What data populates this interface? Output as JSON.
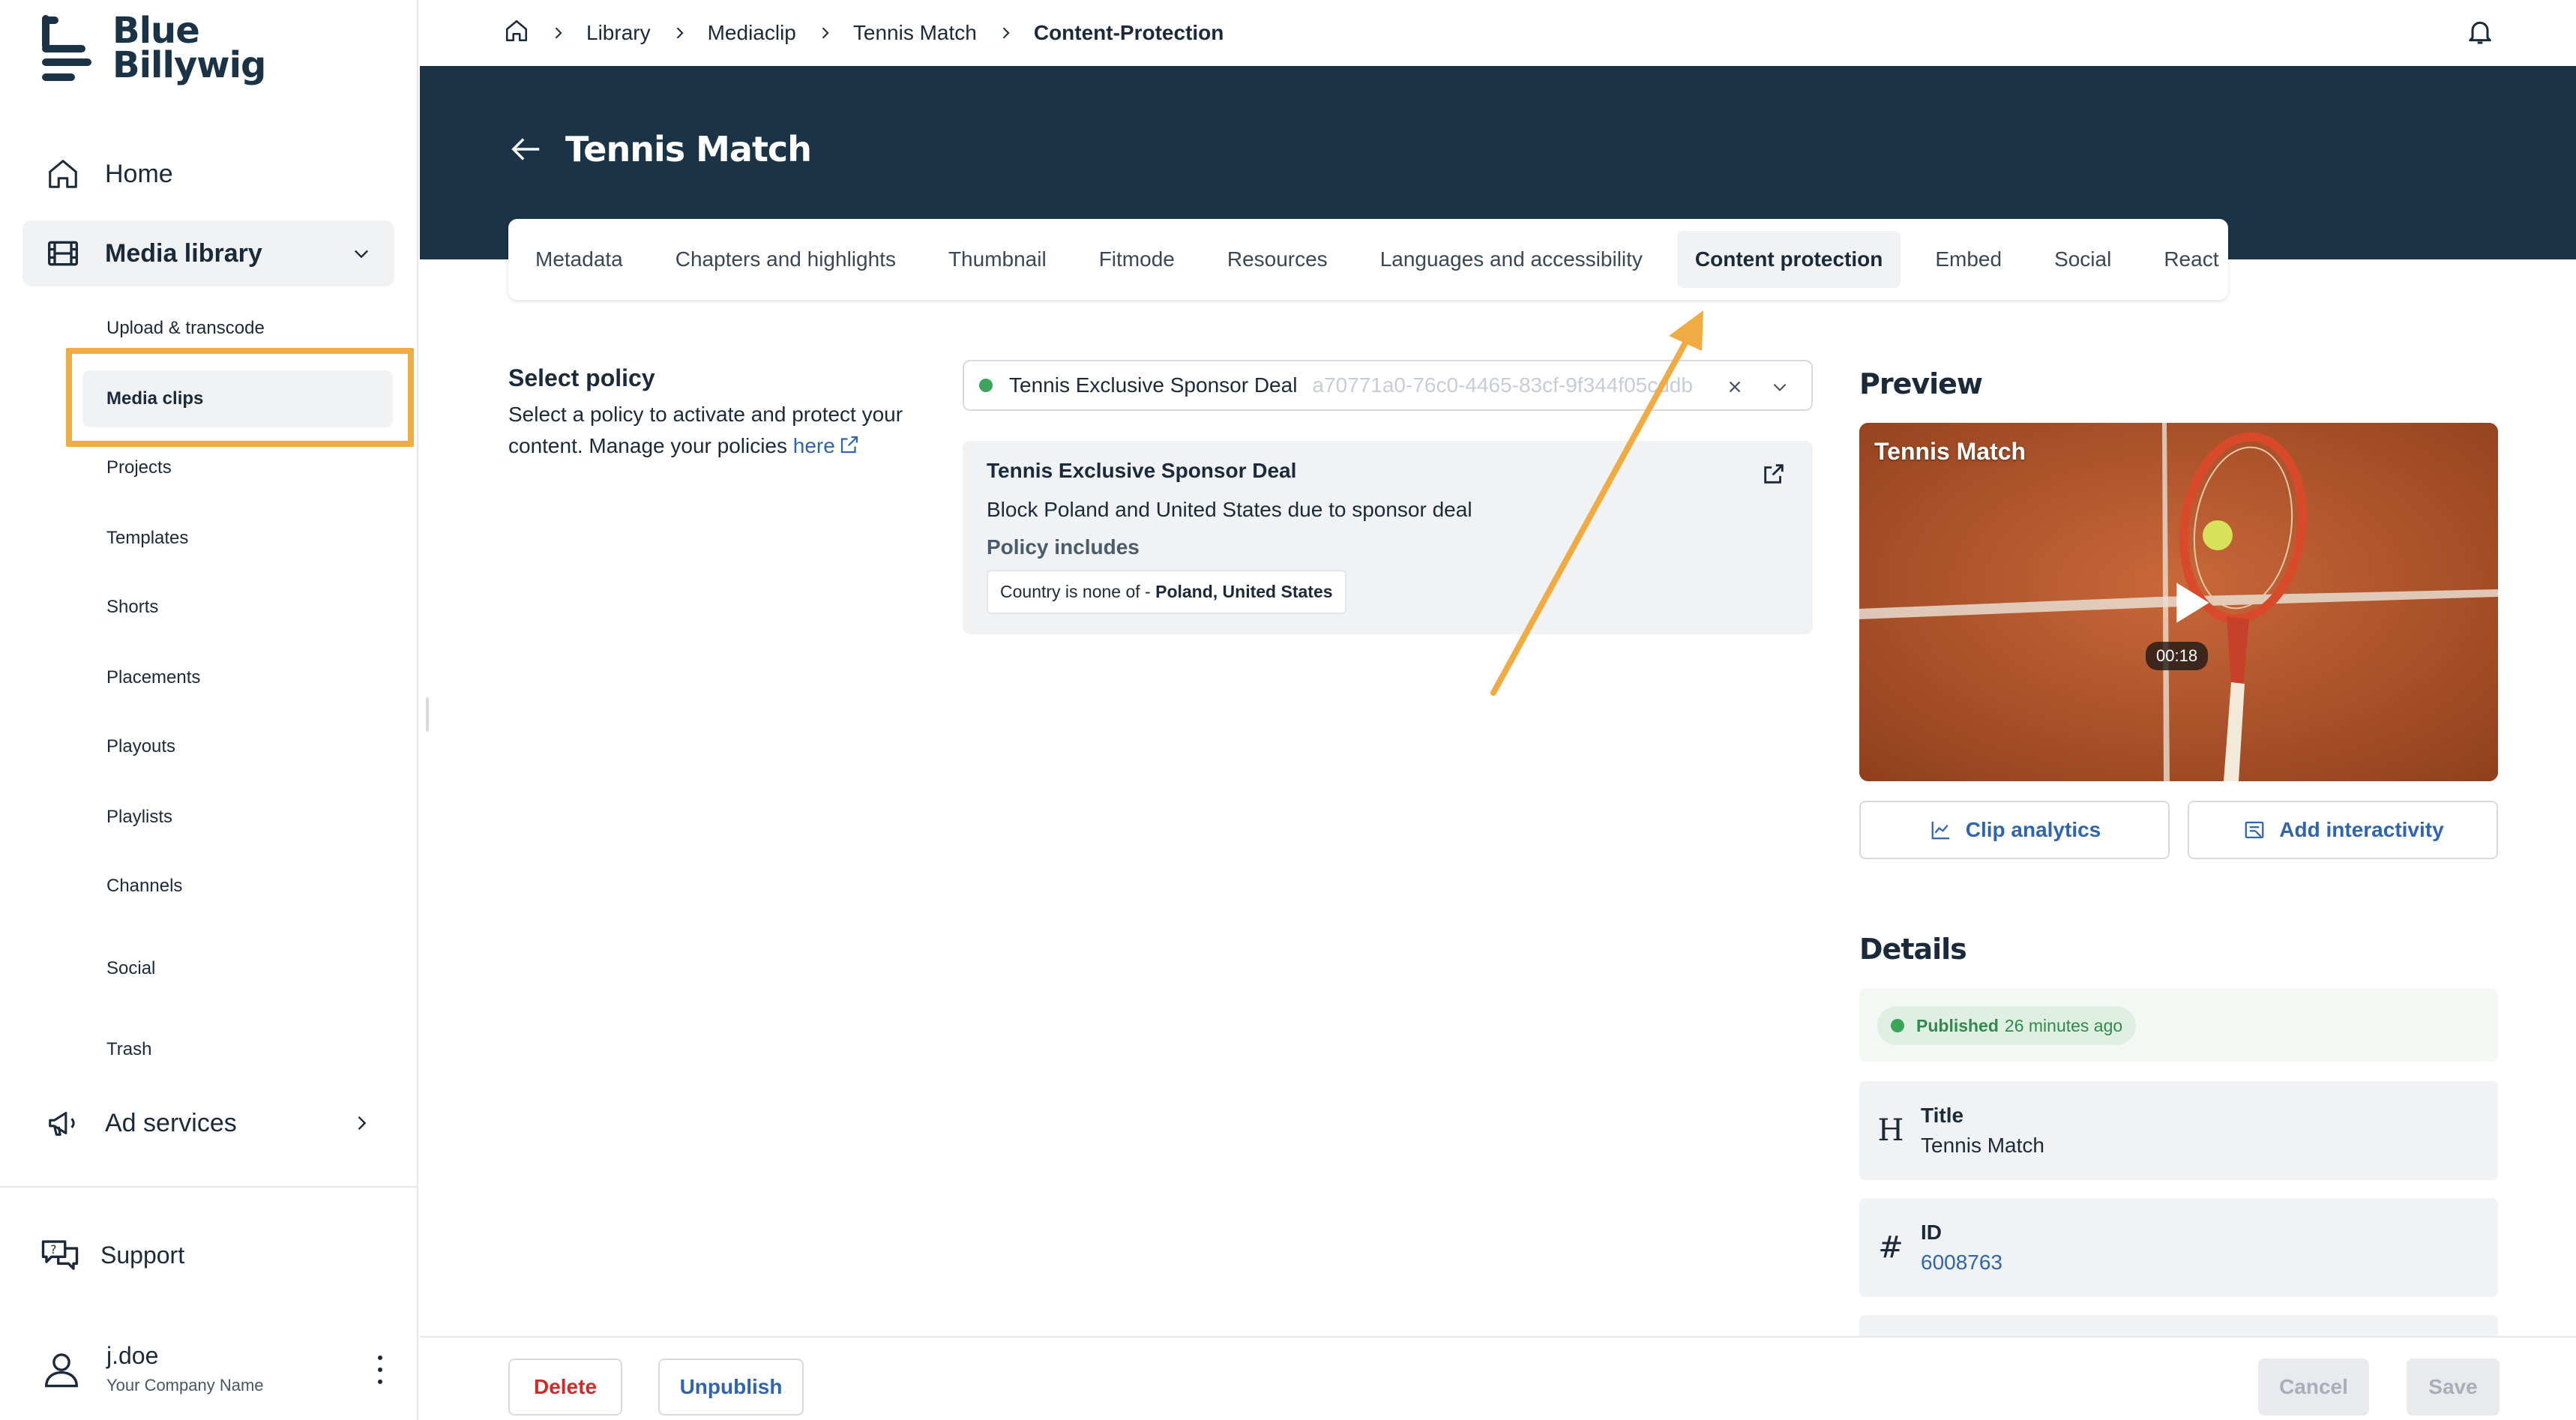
{
  "brand": {
    "line1": "Blue",
    "line2": "Billywig"
  },
  "sidebar": {
    "home": "Home",
    "media_library": "Media library",
    "sub_items": [
      "Upload & transcode",
      "Media clips",
      "Projects",
      "Templates",
      "Shorts",
      "Placements",
      "Playouts",
      "Playlists",
      "Channels",
      "Social",
      "Trash"
    ],
    "active_sub_item": "Media clips",
    "ad_services": "Ad services",
    "support": "Support",
    "user": {
      "name": "j.doe",
      "company": "Your Company Name"
    }
  },
  "breadcrumb": [
    "Library",
    "Mediaclip",
    "Tennis Match",
    "Content-Protection"
  ],
  "page": {
    "title": "Tennis Match"
  },
  "tabs": [
    "Metadata",
    "Chapters and highlights",
    "Thumbnail",
    "Fitmode",
    "Resources",
    "Languages and accessibility",
    "Content protection",
    "Embed",
    "Social",
    "React"
  ],
  "active_tab": "Content protection",
  "policy": {
    "title": "Select policy",
    "desc_text": "Select a policy to activate and protect your content. Manage your policies",
    "link_text": "here",
    "selected_name": "Tennis Exclusive Sponsor Deal",
    "selected_id": "a70771a0-76c0-4465-83cf-9f344f05cddb",
    "card": {
      "name": "Tennis Exclusive Sponsor Deal",
      "description": "Block Poland and United States due to sponsor deal",
      "includes_label": "Policy includes",
      "rule_prefix": "Country is none of - ",
      "rule_values": "Poland, United States"
    }
  },
  "preview": {
    "title": "Preview",
    "video_title": "Tennis Match",
    "duration": "00:18",
    "clip_analytics": "Clip analytics",
    "add_interactivity": "Add interactivity"
  },
  "details": {
    "title": "Details",
    "status": "Published",
    "status_time": "26 minutes ago",
    "title_label": "Title",
    "title_value": "Tennis Match",
    "id_label": "ID",
    "id_value": "6008763"
  },
  "footer": {
    "delete": "Delete",
    "unpublish": "Unpublish",
    "cancel": "Cancel",
    "save": "Save"
  },
  "colors": {
    "navy": "#1b3346",
    "accent_link": "#2f64b0",
    "highlight": "#f0ac43",
    "published_green": "#3aa55b",
    "danger": "#d12a2a"
  }
}
